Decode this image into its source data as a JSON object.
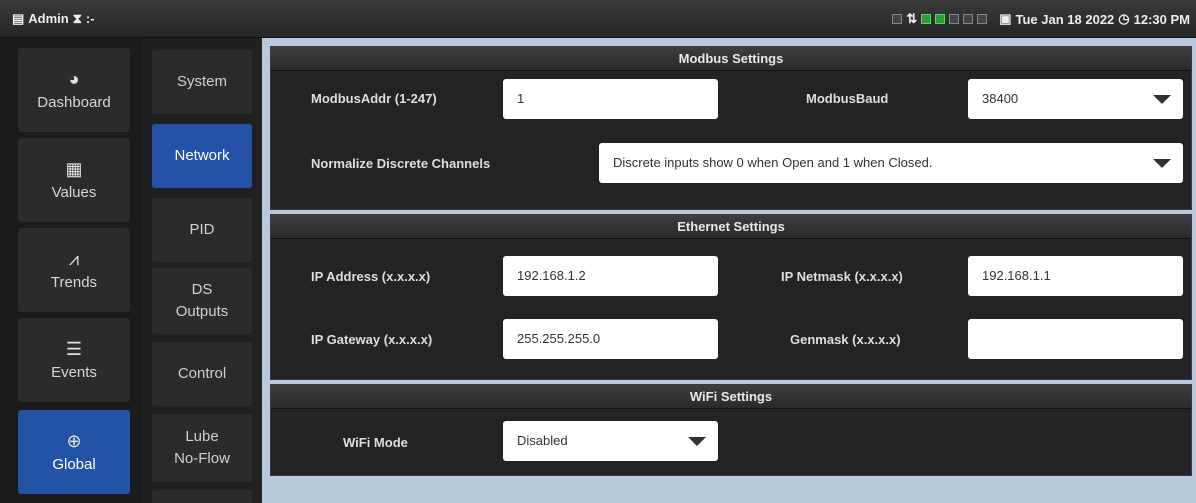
{
  "topbar": {
    "user_label": "Admin",
    "status_text": ":-",
    "date": "Tue Jan 18 2022",
    "time": "12:30 PM",
    "indicator_on_color": "#2f9a3a"
  },
  "nav": {
    "items": [
      {
        "label": "Dashboard",
        "icon": "gauge-icon",
        "glyph": "◕"
      },
      {
        "label": "Values",
        "icon": "grid-icon",
        "glyph": "▦"
      },
      {
        "label": "Trends",
        "icon": "chart-line-icon",
        "glyph": "⩘"
      },
      {
        "label": "Events",
        "icon": "list-icon",
        "glyph": "☰"
      },
      {
        "label": "Global",
        "icon": "globe-icon",
        "glyph": "⊕"
      }
    ]
  },
  "subnav": {
    "items": [
      {
        "label": "System"
      },
      {
        "label": "Network"
      },
      {
        "label": "PID"
      },
      {
        "label": "DS\nOutputs"
      },
      {
        "label": "Control"
      },
      {
        "label": "Lube\nNo-Flow"
      }
    ]
  },
  "modbus": {
    "title": "Modbus Settings",
    "addr_label": "ModbusAddr (1-247)",
    "addr_value": "1",
    "baud_label": "ModbusBaud",
    "baud_value": "38400",
    "normalize_label": "Normalize Discrete Channels",
    "normalize_value": "Discrete inputs show 0 when Open and 1 when Closed."
  },
  "ethernet": {
    "title": "Ethernet Settings",
    "ip_label": "IP Address (x.x.x.x)",
    "ip_value": "192.168.1.2",
    "netmask_label": "IP Netmask (x.x.x.x)",
    "netmask_value": "192.168.1.1",
    "gateway_label": "IP Gateway (x.x.x.x)",
    "gateway_value": "255.255.255.0",
    "genmask_label": "Genmask (x.x.x.x)",
    "genmask_value": ""
  },
  "wifi": {
    "title": "WiFi Settings",
    "mode_label": "WiFi Mode",
    "mode_value": "Disabled"
  },
  "colors": {
    "accent": "#2452a6",
    "content_background": "#b7c9dd"
  }
}
